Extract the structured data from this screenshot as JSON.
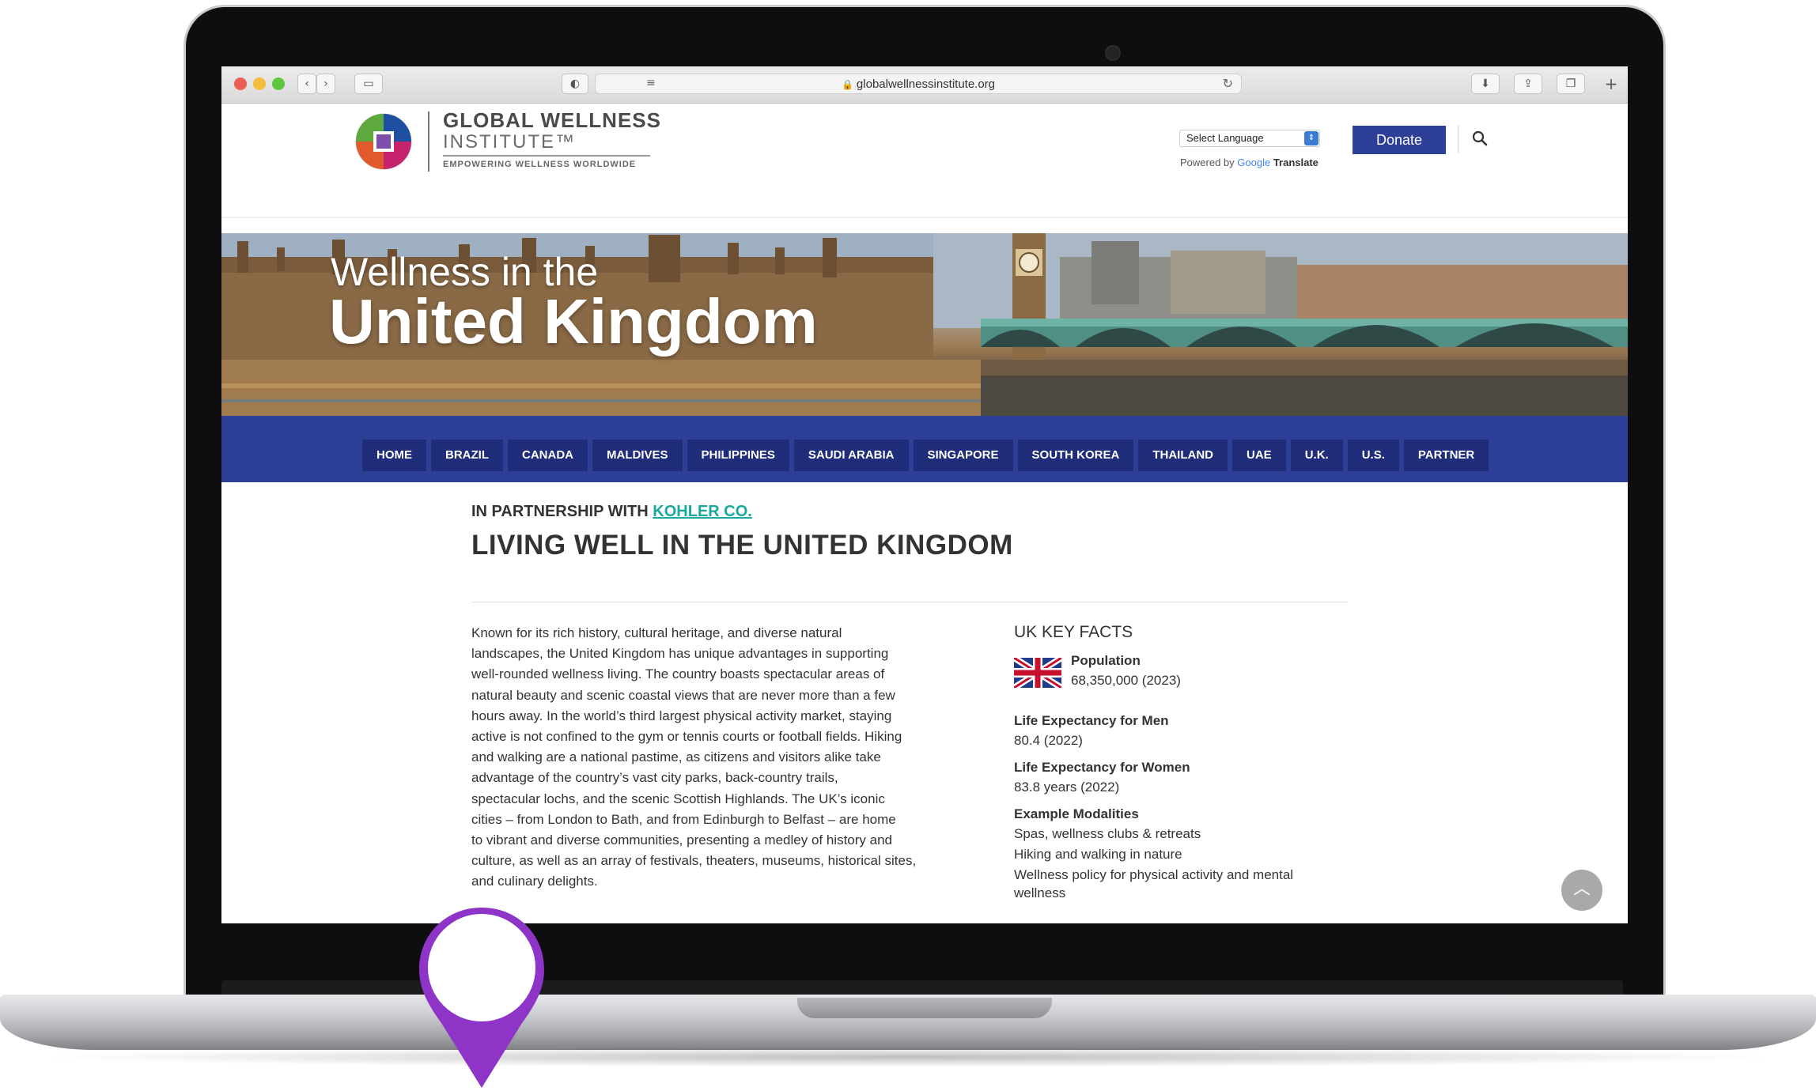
{
  "browser": {
    "url": "globalwellnessinstitute.org"
  },
  "logo": {
    "name": "GLOBAL WELLNESS",
    "sub": "INSTITUTE™",
    "tagline": "EMPOWERING WELLNESS WORLDWIDE"
  },
  "header": {
    "language_select": "Select Language",
    "powered_prefix": "Powered by",
    "powered_google": "Google",
    "powered_translate": "Translate",
    "donate_label": "Donate"
  },
  "hero": {
    "line1": "Wellness in the",
    "line2": "United Kingdom"
  },
  "nav": {
    "items": [
      "HOME",
      "BRAZIL",
      "CANADA",
      "MALDIVES",
      "PHILIPPINES",
      "SAUDI ARABIA",
      "SINGAPORE",
      "SOUTH KOREA",
      "THAILAND",
      "UAE",
      "U.K.",
      "U.S.",
      "PARTNER"
    ]
  },
  "content": {
    "partner_prefix": "IN PARTNERSHIP WITH",
    "partner_link": "KOHLER CO.",
    "title": "LIVING WELL IN THE UNITED KINGDOM",
    "body_lines": [
      "Known for its rich history, cultural heritage, and diverse natural",
      "landscapes, the United Kingdom has unique advantages in supporting",
      "well-rounded wellness living. The country boasts spectacular areas of",
      "natural beauty and scenic coastal views that are never more than a few",
      "hours away. In the world’s third largest physical activity market, staying",
      "active is not confined to the gym or tennis courts or football fields. Hiking",
      "and walking are a national pastime, as citizens and visitors alike take",
      "advantage of the country’s vast city parks, back-country trails,",
      "spectacular lochs, and the scenic Scottish Highlands. The UK’s iconic",
      "cities – from London to Bath, and from Edinburgh to Belfast – are home",
      "to vibrant and diverse communities, presenting a medley of history and",
      "culture, as well as an array of festivals, theaters, museums, historical sites,",
      "and culinary delights."
    ]
  },
  "facts": {
    "title": "UK KEY FACTS",
    "population_label": "Population",
    "population_value": "68,350,000 (2023)",
    "men_label": "Life Expectancy for Men",
    "men_value": "80.4 (2022)",
    "women_label": "Life Expectancy for Women",
    "women_value": "83.8 years (2022)",
    "modalities_label": "Example Modalities",
    "modalities": [
      "Spas, wellness clubs & retreats",
      "Hiking and walking in nature",
      "Wellness policy for physical activity and mental",
      "wellness"
    ]
  },
  "colors": {
    "brand_blue": "#2e3f98",
    "link_teal": "#1aa89c",
    "pin_purple": "#8e35c7"
  }
}
